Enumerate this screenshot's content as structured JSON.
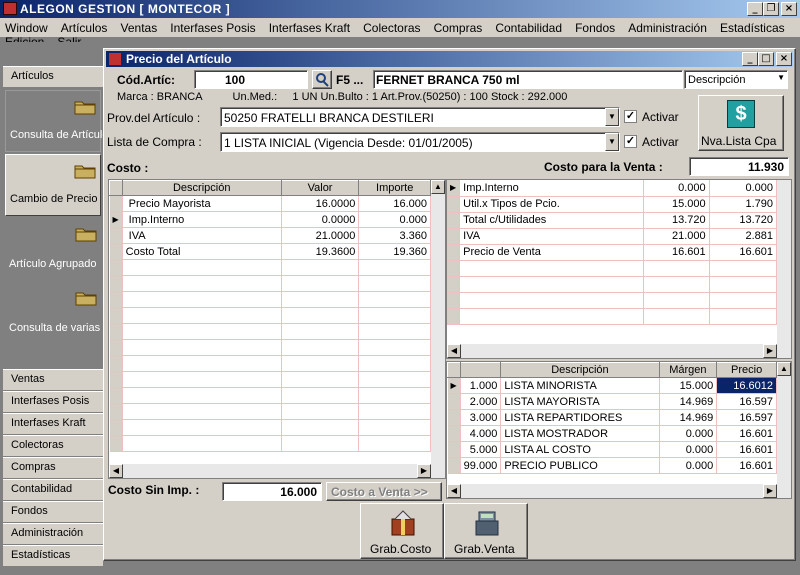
{
  "app": {
    "title": "ALEGON GESTION   [ MONTECOR ]"
  },
  "menubar": [
    "Window",
    "Artículos",
    "Ventas",
    "Interfases Posis",
    "Interfases Kraft",
    "Colectoras",
    "Compras",
    "Contabilidad",
    "Fondos",
    "Administración",
    "Estadísticas",
    "Edicion",
    "Salir"
  ],
  "sidebar": {
    "header": "Artículos",
    "tiles": [
      "Consulta de Artículo",
      "Cambio de Precio",
      "Artículo Agrupado",
      "Consulta de varias"
    ],
    "sections": [
      "Ventas",
      "Interfases Posis",
      "Interfases Kraft",
      "Colectoras",
      "Compras",
      "Contabilidad",
      "Fondos",
      "Administración",
      "Estadísticas"
    ]
  },
  "window": {
    "title": "Precio del Artículo",
    "cod_label": "Cód.Artíc:",
    "cod_value": "100",
    "f5_label": "F5 ...",
    "article_name": "FERNET BRANCA 750 ml",
    "desc_select": "Descripción",
    "info_line": "Marca : BRANCA          Un.Med.:     1 UN Un.Bulto : 1 Art.Prov.(50250) : 100 Stock : 292.000",
    "prov_label": "Prov.del Artículo :",
    "prov_value": "50250 FRATELLI BRANCA DESTILERI",
    "lista_label": "Lista de Compra :",
    "lista_value": "1 LISTA INICIAL (Vigencia Desde: 01/01/2005)",
    "activar_label": "Activar",
    "nva_lista_label": "Nva.Lista Cpa",
    "costo_label": "Costo :",
    "costo_venta_label": "Costo para la Venta :",
    "costo_venta_value": "11.930",
    "costo_sin_imp_label": "Costo Sin Imp. :",
    "costo_sin_imp_value": "16.000",
    "costo_a_venta_label": "Costo a Venta >>",
    "grab_costo_label": "Grab.Costo",
    "grab_venta_label": "Grab.Venta"
  },
  "costo_table": {
    "headers": [
      "Descripción",
      "Valor",
      "Importe"
    ],
    "rows": [
      [
        "Precio Mayorista",
        "16.0000",
        "16.000"
      ],
      [
        "Imp.Interno",
        "0.0000",
        "0.000"
      ],
      [
        "IVA",
        "21.0000",
        "3.360"
      ],
      [
        "Costo Total",
        "19.3600",
        "19.360"
      ]
    ]
  },
  "venta_table": {
    "rows": [
      [
        "Imp.Interno",
        "0.000",
        "0.000"
      ],
      [
        "Util.x Tipos de Pcio.",
        "15.000",
        "1.790"
      ],
      [
        "Total c/Utilidades",
        "13.720",
        "13.720"
      ],
      [
        "IVA",
        "21.000",
        "2.881"
      ],
      [
        "Precio de Venta",
        "16.601",
        "16.601"
      ]
    ]
  },
  "listas_table": {
    "headers": [
      "",
      "Descripción",
      "Márgen",
      "Precio"
    ],
    "rows": [
      [
        "1.000",
        "LISTA MINORISTA",
        "15.000",
        "16.6012"
      ],
      [
        "2.000",
        "LISTA MAYORISTA",
        "14.969",
        "16.597"
      ],
      [
        "3.000",
        "LISTA REPARTIDORES",
        "14.969",
        "16.597"
      ],
      [
        "4.000",
        "LISTA MOSTRADOR",
        "0.000",
        "16.601"
      ],
      [
        "5.000",
        "LISTA AL COSTO",
        "0.000",
        "16.601"
      ],
      [
        "99.000",
        "PRECIO PUBLICO",
        "0.000",
        "16.601"
      ]
    ]
  },
  "colors": {
    "title_start": "#0a246a",
    "title_end": "#a6caf0",
    "selection": "#0a246a",
    "grid_line": "#f0c0c0"
  }
}
